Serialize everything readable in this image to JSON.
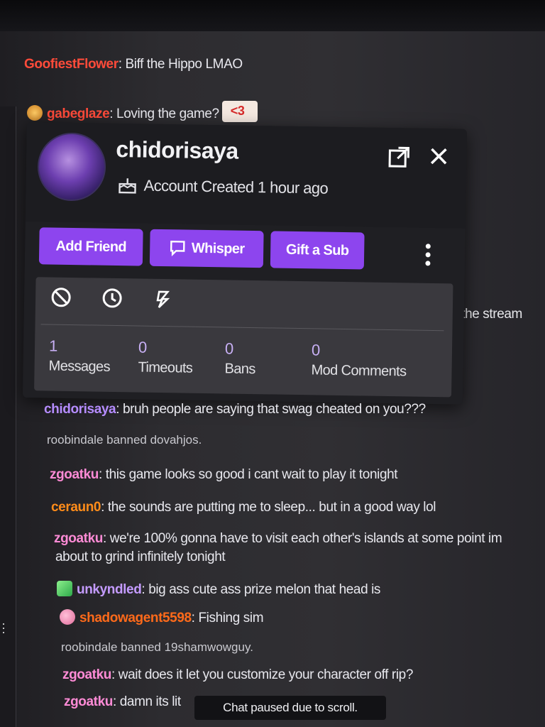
{
  "chat": {
    "messages": [
      {
        "user": "GoofiestFlower",
        "sep": ":",
        "text": " Biff the Hippo LMAO",
        "color": "#ff4b3a"
      },
      {
        "user": "gabeglaze",
        "sep": ":",
        "text": " Loving the game?",
        "emote": "<3",
        "color": "#ff4b3a"
      },
      {
        "user": "chidorisaya",
        "sep": ":",
        "text": " bruh people are saying that swag cheated on you???",
        "color": "#b58cff"
      },
      {
        "system": "roobindale banned dovahjos."
      },
      {
        "user": "zgoatku",
        "sep": ":",
        "text": " this game looks so good i cant wait to play it tonight",
        "color": "#ff8bd6"
      },
      {
        "user": "ceraun0",
        "sep": ":",
        "text": " the sounds are putting me to sleep... but in a good way lol",
        "color": "#ff8c1a"
      },
      {
        "user": "zgoatku",
        "sep": ":",
        "text": " we're 100% gonna have to visit each other's islands at some point im",
        "text2": "about to grind infinitely tonight",
        "color": "#ff8bd6"
      },
      {
        "user": "unkyndled",
        "sep": ":",
        "text": " big ass cute ass prize melon that head is",
        "color": "#c49bff"
      },
      {
        "user": "shadowagent5598",
        "sep": ":",
        "text": " Fishing sim",
        "color": "#ff6a1a"
      },
      {
        "system": "roobindale banned 19shamwowguy."
      },
      {
        "user": "zgoatku",
        "sep": ":",
        "text": " wait does it let you customize your character off rip?",
        "color": "#ff8bd6"
      },
      {
        "user": "zgoatku",
        "sep": ":",
        "text": " damn its lit",
        "color": "#ff8bd6"
      }
    ],
    "partial_text": "w the stream",
    "paused_banner": "Chat paused due to scroll."
  },
  "card": {
    "username": "chidorisaya",
    "account_created": "Account Created 1 hour ago",
    "buttons": {
      "add_friend": "Add Friend",
      "whisper": "Whisper",
      "gift_sub": "Gift a Sub"
    },
    "stats": [
      {
        "value": "1",
        "label": "Messages"
      },
      {
        "value": "0",
        "label": "Timeouts"
      },
      {
        "value": "0",
        "label": "Bans"
      },
      {
        "value": "0",
        "label": "Mod Comments"
      }
    ],
    "icons": [
      "ban-icon",
      "timeout-icon",
      "unban-icon",
      "popout-icon",
      "close-icon",
      "more-options-icon"
    ]
  },
  "colors": {
    "accent": "#8d45ee",
    "card_bg": "#1f1f23",
    "panel_bg": "#3a393e"
  }
}
